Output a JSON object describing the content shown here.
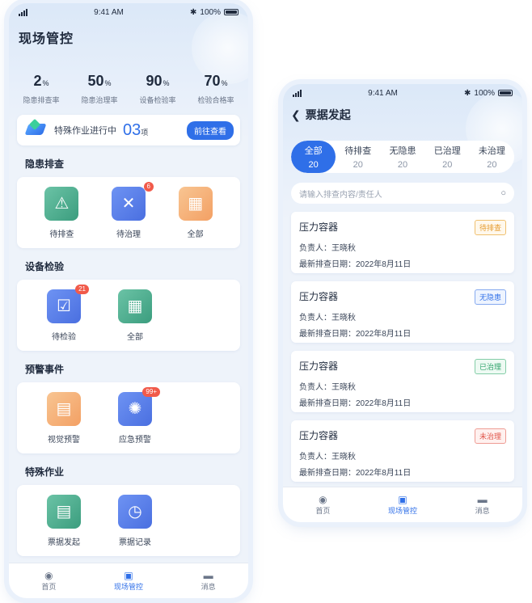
{
  "left": {
    "status": {
      "time": "9:41 AM",
      "battery": "100%"
    },
    "title": "现场管控",
    "stats": [
      {
        "value": "2",
        "unit": "%",
        "label": "隐患排查率"
      },
      {
        "value": "50",
        "unit": "%",
        "label": "隐患治理率"
      },
      {
        "value": "90",
        "unit": "%",
        "label": "设备检验率"
      },
      {
        "value": "70",
        "unit": "%",
        "label": "检验合格率"
      }
    ],
    "special": {
      "text": "特殊作业进行中",
      "count": "03",
      "unit": "项",
      "button": "前往查看"
    },
    "sections": [
      {
        "title": "隐患排查",
        "items": [
          {
            "label": "待排查",
            "color": "green",
            "icon": "warning-search-icon",
            "glyph": "⚠",
            "badge": ""
          },
          {
            "label": "待治理",
            "color": "blue",
            "icon": "tools-icon",
            "glyph": "✕",
            "badge": "6"
          },
          {
            "label": "全部",
            "color": "orange",
            "icon": "grid-icon",
            "glyph": "▦",
            "badge": ""
          }
        ]
      },
      {
        "title": "设备检验",
        "items": [
          {
            "label": "待检验",
            "color": "blue",
            "icon": "clipboard-check-icon",
            "glyph": "☑",
            "badge": "21"
          },
          {
            "label": "全部",
            "color": "green",
            "icon": "grid-icon",
            "glyph": "▦",
            "badge": ""
          }
        ]
      },
      {
        "title": "预警事件",
        "items": [
          {
            "label": "视觉预警",
            "color": "orange",
            "icon": "document-warning-icon",
            "glyph": "▤",
            "badge": ""
          },
          {
            "label": "应急预警",
            "color": "blue",
            "icon": "siren-icon",
            "glyph": "✺",
            "badge": "99+"
          }
        ]
      },
      {
        "title": "特殊作业",
        "items": [
          {
            "label": "票据发起",
            "color": "green",
            "icon": "document-icon",
            "glyph": "▤",
            "badge": ""
          },
          {
            "label": "票据记录",
            "color": "blue",
            "icon": "document-clock-icon",
            "glyph": "◷",
            "badge": ""
          }
        ]
      }
    ],
    "tabs": [
      {
        "label": "首页",
        "icon": "location-pin-icon",
        "glyph": "◉",
        "active": false
      },
      {
        "label": "现场管控",
        "icon": "clipboard-icon",
        "glyph": "▣",
        "active": true
      },
      {
        "label": "消息",
        "icon": "chat-icon",
        "glyph": "▬",
        "active": false
      }
    ]
  },
  "right": {
    "status": {
      "time": "9:41 AM",
      "battery": "100%"
    },
    "back_glyph": "❮",
    "title": "票据发起",
    "filters": [
      {
        "label": "全部",
        "count": "20",
        "active": true
      },
      {
        "label": "待排查",
        "count": "20",
        "active": false
      },
      {
        "label": "无隐患",
        "count": "20",
        "active": false
      },
      {
        "label": "已治理",
        "count": "20",
        "active": false
      },
      {
        "label": "未治理",
        "count": "20",
        "active": false
      }
    ],
    "search_placeholder": "请输入排查内容/责任人",
    "tickets": [
      {
        "title": "压力容器",
        "owner": "负责人：王晓秋",
        "date": "最新排查日期：2022年8月11日",
        "status": "待排查",
        "status_color": "orange"
      },
      {
        "title": "压力容器",
        "owner": "负责人：王晓秋",
        "date": "最新排查日期：2022年8月11日",
        "status": "无隐患",
        "status_color": "blue"
      },
      {
        "title": "压力容器",
        "owner": "负责人：王晓秋",
        "date": "最新排查日期：2022年8月11日",
        "status": "已治理",
        "status_color": "green"
      },
      {
        "title": "压力容器",
        "owner": "负责人：王晓秋",
        "date": "最新排查日期：2022年8月11日",
        "status": "未治理",
        "status_color": "red"
      }
    ],
    "tabs": [
      {
        "label": "首页",
        "icon": "location-pin-icon",
        "glyph": "◉",
        "active": false
      },
      {
        "label": "现场管控",
        "icon": "clipboard-icon",
        "glyph": "▣",
        "active": true
      },
      {
        "label": "消息",
        "icon": "chat-icon",
        "glyph": "▬",
        "active": false
      }
    ]
  }
}
